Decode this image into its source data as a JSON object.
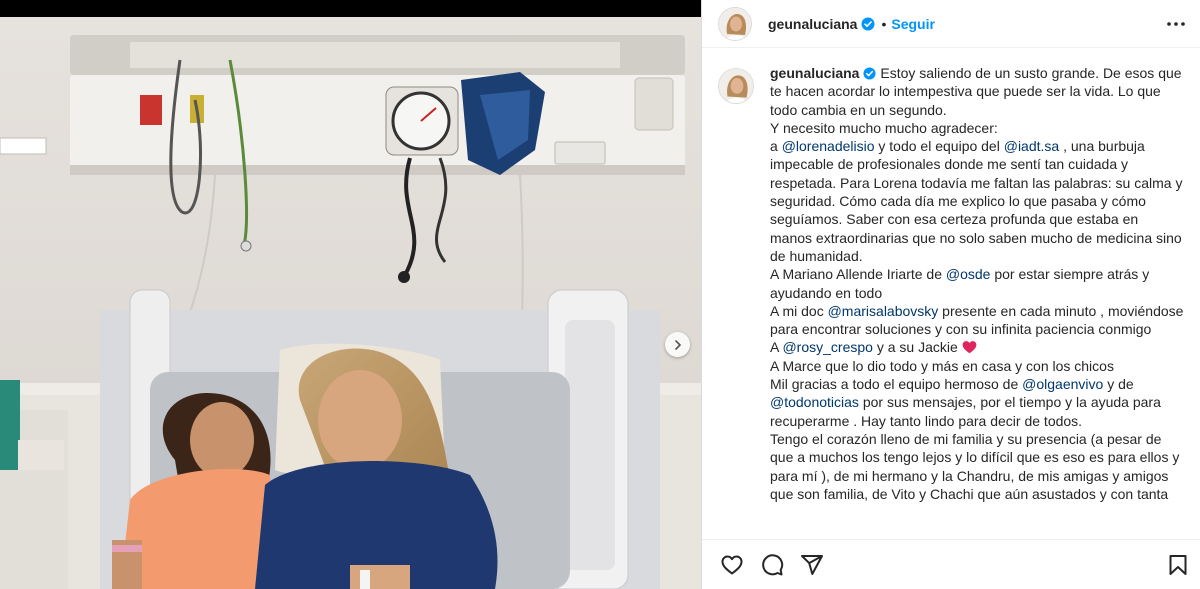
{
  "post": {
    "username": "geunaluciana",
    "verified": true,
    "separator": "•",
    "follow_label": "Seguir"
  },
  "icons": {
    "more": "more-horizontal-icon",
    "next": "chevron-right-icon",
    "like": "heart-outline-icon",
    "comment": "comment-bubble-icon",
    "share": "paper-plane-icon",
    "save": "bookmark-icon",
    "verified": "verified-badge-icon"
  },
  "colors": {
    "accent": "#0095f6",
    "mention": "#00376b",
    "heart_emoji": "#e0245e"
  },
  "caption": {
    "lines": [
      [
        {
          "t": "Estoy saliendo de un susto grande. De esos que te hacen acordar lo intempestiva que puede ser la vida. Lo que todo cambia en un segundo."
        }
      ],
      [
        {
          "t": "Y necesito mucho mucho agradecer:"
        }
      ],
      [
        {
          "t": "a "
        },
        {
          "m": "@lorenadelisio"
        },
        {
          "t": " y todo el equipo del "
        },
        {
          "m": "@iadt.sa"
        },
        {
          "t": " , una burbuja impecable de profesionales donde me sentí tan cuidada y respetada. Para Lorena todavía me faltan las palabras: su calma y seguridad. Cómo cada día me explico lo que pasaba y cómo seguíamos. Saber con esa certeza profunda que estaba en manos extraordinarias que no solo saben mucho de medicina sino de humanidad."
        }
      ],
      [
        {
          "t": "A Mariano Allende Iriarte de "
        },
        {
          "m": "@osde"
        },
        {
          "t": " por estar siempre atrás y ayudando en todo"
        }
      ],
      [
        {
          "t": "A mi doc "
        },
        {
          "m": "@marisalabovsky"
        },
        {
          "t": " presente en cada minuto , moviéndose para encontrar soluciones y con su infinita paciencia conmigo"
        }
      ],
      [
        {
          "t": "A "
        },
        {
          "m": "@rosy_crespo"
        },
        {
          "t": " y a su Jackie "
        },
        {
          "e": "heart"
        }
      ],
      [
        {
          "t": "A Marce que lo dio todo y más en casa y con los chicos"
        }
      ],
      [
        {
          "t": "Mil gracias a todo el equipo hermoso de "
        },
        {
          "m": "@olgaenvivo"
        },
        {
          "t": " y de "
        },
        {
          "m": "@todonoticias"
        },
        {
          "t": " por sus mensajes, por el tiempo y la ayuda para recuperarme . Hay tanto lindo para decir de todos."
        }
      ],
      [
        {
          "t": "Tengo el corazón lleno de mi familia y su presencia (a pesar de que a muchos los tengo lejos y lo difícil que es eso es para ellos y para mí ), de mi hermano y la Chandru, de mis amigas y amigos que son familia, de Vito y Chachi que aún asustados y con tanta"
        }
      ]
    ]
  }
}
